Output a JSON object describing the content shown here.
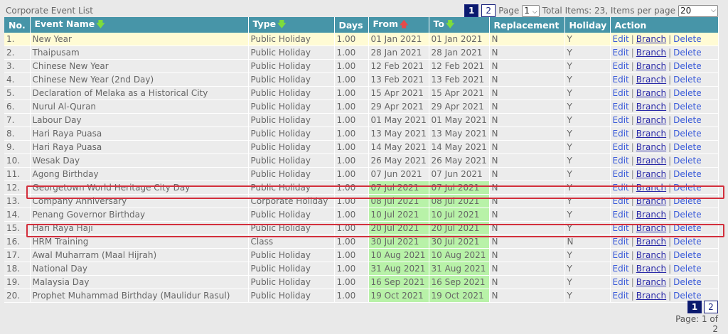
{
  "header": {
    "title": "Corporate Event List",
    "page_label": "Page",
    "page_select": "1",
    "total_text": "Total Items: 23, Items per page",
    "per_page_select": "20",
    "pages": [
      "1",
      "2"
    ]
  },
  "columns": {
    "no": "No.",
    "name": "Event Name",
    "type": "Type",
    "days": "Days",
    "from": "From",
    "to": "To",
    "replacement": "Replacement",
    "holiday": "Holiday",
    "action": "Action"
  },
  "actions": {
    "edit": "Edit",
    "branch": "Branch",
    "delete": "Delete",
    "sep": "|"
  },
  "rows": [
    {
      "no": "1.",
      "name": "New Year",
      "type": "Public Holiday",
      "days": "1.00",
      "from": "01 Jan 2021",
      "to": "01 Jan 2021",
      "rep": "N",
      "hol": "Y",
      "green": false
    },
    {
      "no": "2.",
      "name": "Thaipusam",
      "type": "Public Holiday",
      "days": "1.00",
      "from": "28 Jan 2021",
      "to": "28 Jan 2021",
      "rep": "N",
      "hol": "Y",
      "green": false
    },
    {
      "no": "3.",
      "name": "Chinese New Year",
      "type": "Public Holiday",
      "days": "1.00",
      "from": "12 Feb 2021",
      "to": "12 Feb 2021",
      "rep": "N",
      "hol": "Y",
      "green": false
    },
    {
      "no": "4.",
      "name": "Chinese New Year (2nd Day)",
      "type": "Public Holiday",
      "days": "1.00",
      "from": "13 Feb 2021",
      "to": "13 Feb 2021",
      "rep": "N",
      "hol": "Y",
      "green": false
    },
    {
      "no": "5.",
      "name": "Declaration of Melaka as a Historical City",
      "type": "Public Holiday",
      "days": "1.00",
      "from": "15 Apr 2021",
      "to": "15 Apr 2021",
      "rep": "N",
      "hol": "Y",
      "green": false
    },
    {
      "no": "6.",
      "name": "Nurul Al-Quran",
      "type": "Public Holiday",
      "days": "1.00",
      "from": "29 Apr 2021",
      "to": "29 Apr 2021",
      "rep": "N",
      "hol": "Y",
      "green": false
    },
    {
      "no": "7.",
      "name": "Labour Day",
      "type": "Public Holiday",
      "days": "1.00",
      "from": "01 May 2021",
      "to": "01 May 2021",
      "rep": "N",
      "hol": "Y",
      "green": false
    },
    {
      "no": "8.",
      "name": "Hari Raya Puasa",
      "type": "Public Holiday",
      "days": "1.00",
      "from": "13 May 2021",
      "to": "13 May 2021",
      "rep": "N",
      "hol": "Y",
      "green": false
    },
    {
      "no": "9.",
      "name": "Hari Raya Puasa",
      "type": "Public Holiday",
      "days": "1.00",
      "from": "14 May 2021",
      "to": "14 May 2021",
      "rep": "N",
      "hol": "Y",
      "green": false
    },
    {
      "no": "10.",
      "name": "Wesak Day",
      "type": "Public Holiday",
      "days": "1.00",
      "from": "26 May 2021",
      "to": "26 May 2021",
      "rep": "N",
      "hol": "Y",
      "green": false
    },
    {
      "no": "11.",
      "name": "Agong Birthday",
      "type": "Public Holiday",
      "days": "1.00",
      "from": "07 Jun 2021",
      "to": "07 Jun 2021",
      "rep": "N",
      "hol": "Y",
      "green": false
    },
    {
      "no": "12.",
      "name": "Georgetown World Heritage City Day",
      "type": "Public Holiday",
      "days": "1.00",
      "from": "07 Jul 2021",
      "to": "07 Jul 2021",
      "rep": "N",
      "hol": "Y",
      "green": true
    },
    {
      "no": "13.",
      "name": "Company Anniversary",
      "type": "Corporate Holiday",
      "days": "1.00",
      "from": "08 Jul 2021",
      "to": "08 Jul 2021",
      "rep": "N",
      "hol": "Y",
      "green": true
    },
    {
      "no": "14.",
      "name": "Penang Governor Birthday",
      "type": "Public Holiday",
      "days": "1.00",
      "from": "10 Jul 2021",
      "to": "10 Jul 2021",
      "rep": "N",
      "hol": "Y",
      "green": true
    },
    {
      "no": "15.",
      "name": "Hari Raya Haji",
      "type": "Public Holiday",
      "days": "1.00",
      "from": "20 Jul 2021",
      "to": "20 Jul 2021",
      "rep": "N",
      "hol": "Y",
      "green": true
    },
    {
      "no": "16.",
      "name": "HRM Training",
      "type": "Class",
      "days": "1.00",
      "from": "30 Jul 2021",
      "to": "30 Jul 2021",
      "rep": "N",
      "hol": "N",
      "green": true
    },
    {
      "no": "17.",
      "name": "Awal Muharram (Maal Hijrah)",
      "type": "Public Holiday",
      "days": "1.00",
      "from": "10 Aug 2021",
      "to": "10 Aug 2021",
      "rep": "N",
      "hol": "Y",
      "green": true
    },
    {
      "no": "18.",
      "name": "National Day",
      "type": "Public Holiday",
      "days": "1.00",
      "from": "31 Aug 2021",
      "to": "31 Aug 2021",
      "rep": "N",
      "hol": "Y",
      "green": true
    },
    {
      "no": "19.",
      "name": "Malaysia Day",
      "type": "Public Holiday",
      "days": "1.00",
      "from": "16 Sep 2021",
      "to": "16 Sep 2021",
      "rep": "N",
      "hol": "Y",
      "green": true
    },
    {
      "no": "20.",
      "name": "Prophet Muhammad Birthday (Maulidur Rasul)",
      "type": "Public Holiday",
      "days": "1.00",
      "from": "19 Oct 2021",
      "to": "19 Oct 2021",
      "rep": "N",
      "hol": "Y",
      "green": true
    }
  ],
  "footer": {
    "pages": [
      "1",
      "2"
    ],
    "page_info": "Page: 1 of 2"
  },
  "colors": {
    "header_bg": "#4795a8",
    "highlight_border": "#d32f3c",
    "date_green": "#b8f2a8",
    "first_row": "#fffbd4"
  }
}
